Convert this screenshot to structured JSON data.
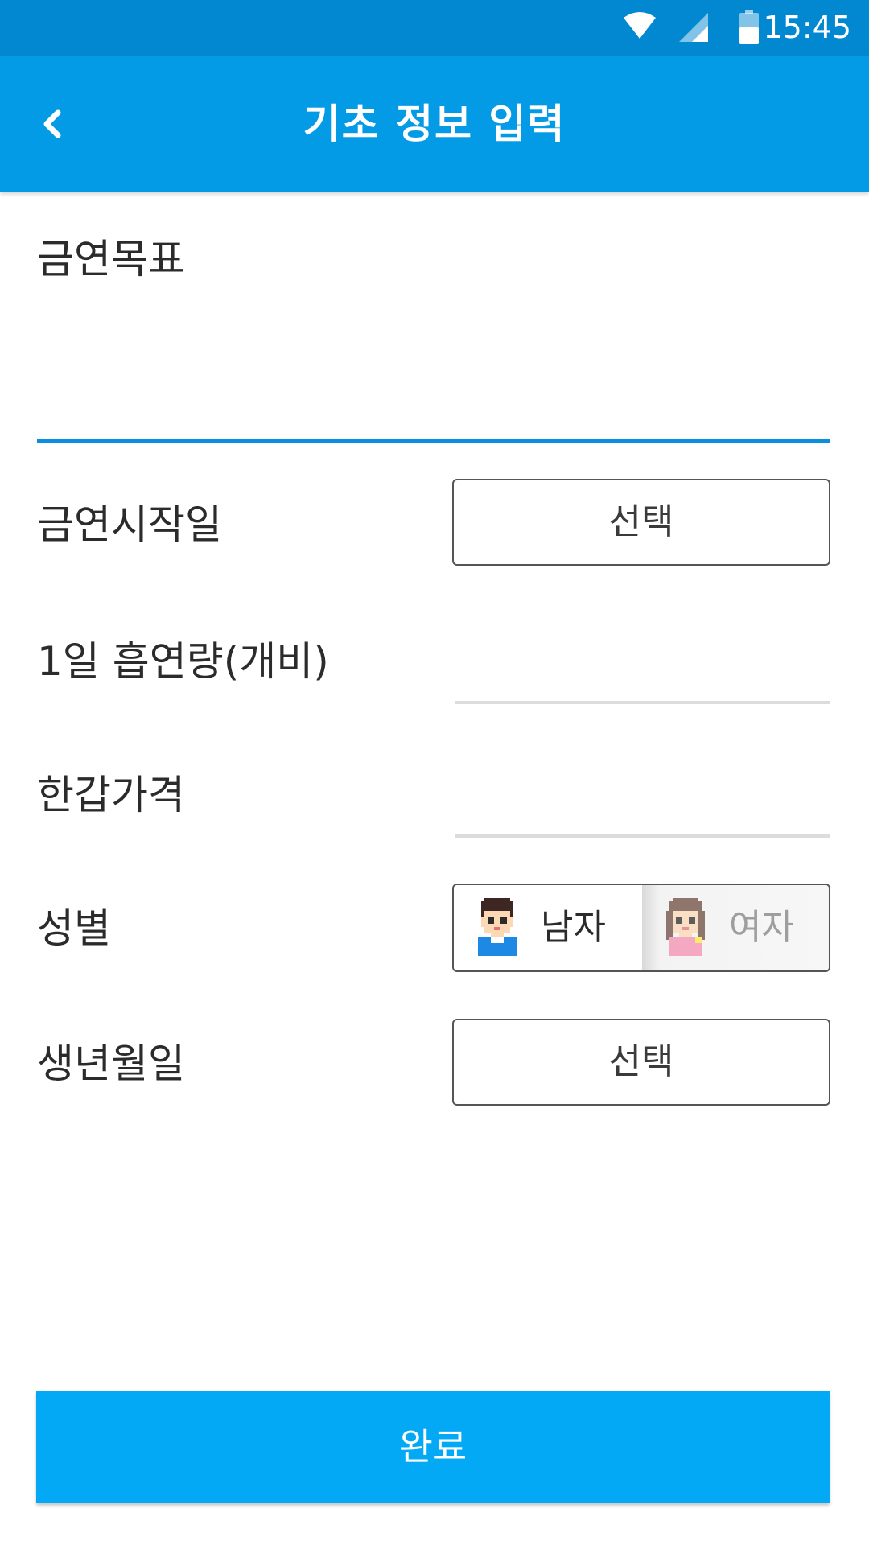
{
  "status_bar": {
    "time": "15:45",
    "icons": [
      "wifi-icon",
      "signal-icon",
      "battery-icon"
    ]
  },
  "app_bar": {
    "title": "기초 정보 입력",
    "back_icon": "chevron-left-icon"
  },
  "form": {
    "goal_label": "금연목표",
    "goal_value": "",
    "start_date_label": "금연시작일",
    "start_date_button": "선택",
    "daily_amount_label": "1일 흡연량(개비)",
    "daily_amount_value": "",
    "pack_price_label": "한갑가격",
    "pack_price_value": "",
    "gender_label": "성별",
    "gender_options": [
      {
        "label": "남자",
        "avatar": "male-avatar-icon",
        "selected": true
      },
      {
        "label": "여자",
        "avatar": "female-avatar-icon",
        "selected": false
      }
    ],
    "birthdate_label": "생년월일",
    "birthdate_button": "선택"
  },
  "done_button": "완료",
  "colors": {
    "status_bar": "#0288d1",
    "app_bar": "#039be5",
    "accent": "#0a8fe0",
    "done_button": "#03a9f4"
  }
}
